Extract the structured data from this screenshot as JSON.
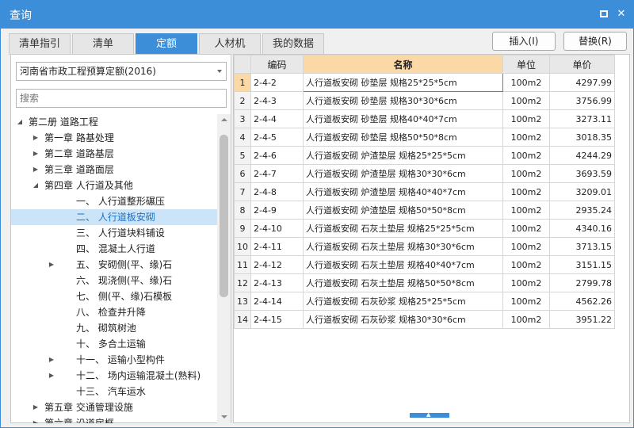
{
  "window": {
    "title": "查询"
  },
  "tabs": [
    {
      "label": "清单指引",
      "active": false
    },
    {
      "label": "清单",
      "active": false
    },
    {
      "label": "定额",
      "active": true
    },
    {
      "label": "人材机",
      "active": false
    },
    {
      "label": "我的数据",
      "active": false
    }
  ],
  "buttons": {
    "insert": "插入(I)",
    "replace": "替换(R)"
  },
  "library_select": {
    "value": "河南省市政工程预算定额(2016)"
  },
  "search": {
    "placeholder": "搜索"
  },
  "tree": [
    {
      "label": "第二册 道路工程",
      "level": 0,
      "toggle": "expanded"
    },
    {
      "label": "第一章 路基处理",
      "level": 1,
      "toggle": "collapsed"
    },
    {
      "label": "第二章 道路基层",
      "level": 1,
      "toggle": "collapsed"
    },
    {
      "label": "第三章 道路面层",
      "level": 1,
      "toggle": "collapsed"
    },
    {
      "label": "第四章 人行道及其他",
      "level": 1,
      "toggle": "expanded"
    },
    {
      "label": "一、 人行道整形碾压",
      "level": 2,
      "toggle": "none"
    },
    {
      "label": "二、 人行道板安砌",
      "level": 2,
      "toggle": "none",
      "selected": true
    },
    {
      "label": "三、 人行道块料铺设",
      "level": 2,
      "toggle": "none"
    },
    {
      "label": "四、 混凝土人行道",
      "level": 2,
      "toggle": "none"
    },
    {
      "label": "五、 安砌侧(平、缘)石",
      "level": 2,
      "toggle": "collapsed"
    },
    {
      "label": "六、 现浇侧(平、缘)石",
      "level": 2,
      "toggle": "none"
    },
    {
      "label": "七、 侧(平、缘)石模板",
      "level": 2,
      "toggle": "none"
    },
    {
      "label": "八、 检查井升降",
      "level": 2,
      "toggle": "none"
    },
    {
      "label": "九、 砌筑树池",
      "level": 2,
      "toggle": "none"
    },
    {
      "label": "十、 多合土运输",
      "level": 2,
      "toggle": "none"
    },
    {
      "label": "十一、 运输小型构件",
      "level": 2,
      "toggle": "collapsed"
    },
    {
      "label": "十二、 场内运输混凝土(熟料)",
      "level": 2,
      "toggle": "collapsed"
    },
    {
      "label": "十三、 汽车运水",
      "level": 2,
      "toggle": "none"
    },
    {
      "label": "第五章 交通管理设施",
      "level": 1,
      "toggle": "collapsed"
    },
    {
      "label": "第六章 沿道房框",
      "level": 1,
      "toggle": "collapsed"
    }
  ],
  "table": {
    "headers": {
      "code": "编码",
      "name": "名称",
      "unit": "单位",
      "price": "单价"
    },
    "rows": [
      {
        "n": "1",
        "code": "2-4-2",
        "name": "人行道板安砌 砂垫层 规格25*25*5cm",
        "unit": "100m2",
        "price": "4297.99"
      },
      {
        "n": "2",
        "code": "2-4-3",
        "name": "人行道板安砌 砂垫层 规格30*30*6cm",
        "unit": "100m2",
        "price": "3756.99"
      },
      {
        "n": "3",
        "code": "2-4-4",
        "name": "人行道板安砌 砂垫层 规格40*40*7cm",
        "unit": "100m2",
        "price": "3273.11"
      },
      {
        "n": "4",
        "code": "2-4-5",
        "name": "人行道板安砌 砂垫层 规格50*50*8cm",
        "unit": "100m2",
        "price": "3018.35"
      },
      {
        "n": "5",
        "code": "2-4-6",
        "name": "人行道板安砌 炉渣垫层 规格25*25*5cm",
        "unit": "100m2",
        "price": "4244.29"
      },
      {
        "n": "6",
        "code": "2-4-7",
        "name": "人行道板安砌 炉渣垫层 规格30*30*6cm",
        "unit": "100m2",
        "price": "3693.59"
      },
      {
        "n": "7",
        "code": "2-4-8",
        "name": "人行道板安砌 炉渣垫层 规格40*40*7cm",
        "unit": "100m2",
        "price": "3209.01"
      },
      {
        "n": "8",
        "code": "2-4-9",
        "name": "人行道板安砌 炉渣垫层 规格50*50*8cm",
        "unit": "100m2",
        "price": "2935.24"
      },
      {
        "n": "9",
        "code": "2-4-10",
        "name": "人行道板安砌 石灰土垫层 规格25*25*5cm",
        "unit": "100m2",
        "price": "4340.16"
      },
      {
        "n": "10",
        "code": "2-4-11",
        "name": "人行道板安砌 石灰土垫层 规格30*30*6cm",
        "unit": "100m2",
        "price": "3713.15"
      },
      {
        "n": "11",
        "code": "2-4-12",
        "name": "人行道板安砌 石灰土垫层 规格40*40*7cm",
        "unit": "100m2",
        "price": "3151.15"
      },
      {
        "n": "12",
        "code": "2-4-13",
        "name": "人行道板安砌 石灰土垫层 规格50*50*8cm",
        "unit": "100m2",
        "price": "2799.78"
      },
      {
        "n": "13",
        "code": "2-4-14",
        "name": "人行道板安砌 石灰砂浆 规格25*25*5cm",
        "unit": "100m2",
        "price": "4562.26"
      },
      {
        "n": "14",
        "code": "2-4-15",
        "name": "人行道板安砌 石灰砂浆 规格30*30*6cm",
        "unit": "100m2",
        "price": "3951.22"
      }
    ]
  }
}
